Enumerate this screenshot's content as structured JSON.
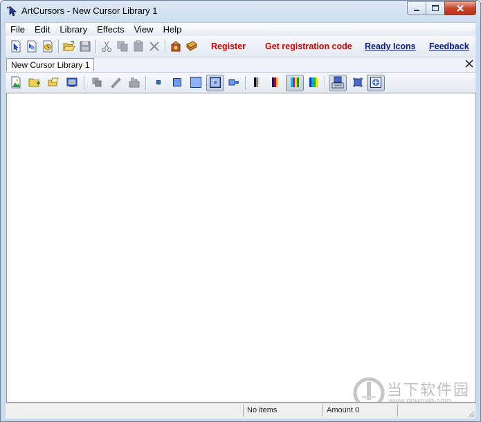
{
  "window": {
    "title": "ArtCursors - New Cursor Library 1"
  },
  "menu": {
    "items": [
      "File",
      "Edit",
      "Library",
      "Effects",
      "View",
      "Help"
    ]
  },
  "toolbar": {
    "links": {
      "register": "Register",
      "get_code": "Get registration code",
      "ready_icons": "Ready Icons",
      "feedback": "Feedback"
    }
  },
  "tabs": {
    "items": [
      "New Cursor Library 1"
    ]
  },
  "status": {
    "items_text": "No items",
    "amount_text": "Amount 0"
  },
  "watermark": {
    "cn": "当下软件园",
    "url": "www.downxia.com"
  },
  "colors": {
    "link_red": "#d40000",
    "link_blue": "#0a1a8c"
  },
  "icons": {
    "toolbar1": [
      "new-cursor-icon",
      "new-animated-cursor-icon",
      "new-from-image-icon",
      "open-folder-icon",
      "save-icon",
      "cut-icon",
      "copy-icon",
      "paste-icon",
      "delete-icon",
      "wizard-icon",
      "book-icon"
    ],
    "toolbar2": [
      "add-image-icon",
      "add-folder-icon",
      "add-files-icon",
      "import-icon",
      "duplicate-icon",
      "edit-icon",
      "properties-icon",
      "size-small-icon",
      "size-medium-icon",
      "size-large-icon",
      "size-fit-icon",
      "size-list-icon",
      "color-mono-icon",
      "color-16-icon",
      "color-256-icon",
      "color-true-icon",
      "view-details-icon",
      "view-hotspot-icon",
      "view-preview-icon"
    ]
  }
}
